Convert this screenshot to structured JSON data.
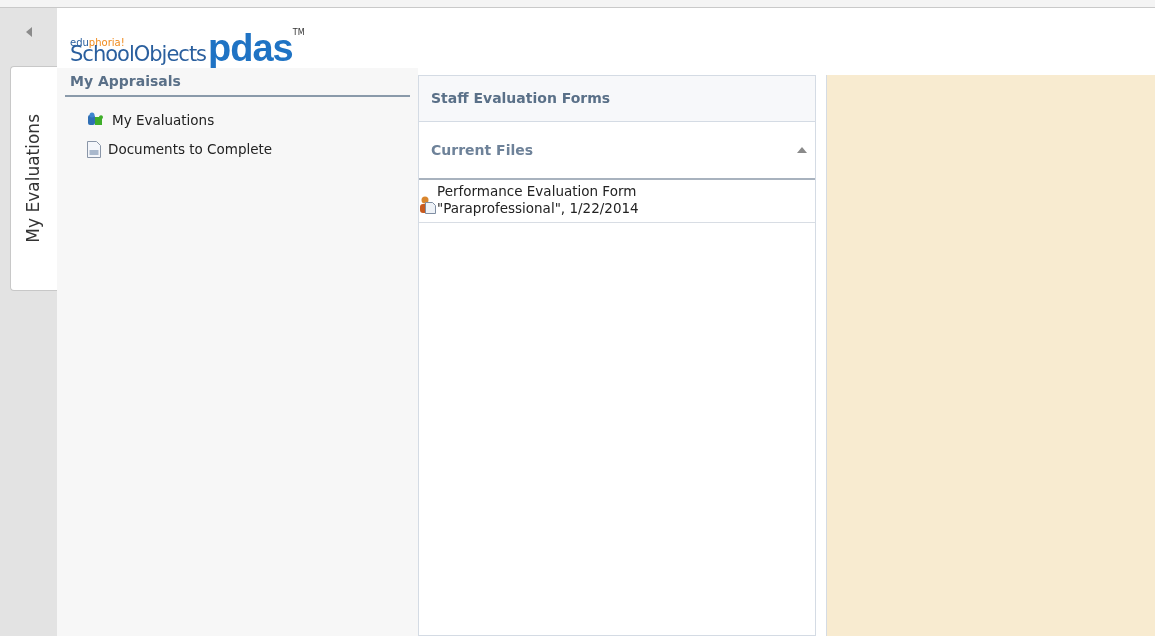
{
  "side_tab": {
    "label": "My Evaluations",
    "selected": true
  },
  "logo": {
    "prefix_a": "edu",
    "prefix_b": "phoria!",
    "name": "SchoolObjects",
    "product": "pdas",
    "mark": "TM"
  },
  "sidebar": {
    "title": "My Appraisals",
    "items": [
      {
        "label": "My Evaluations",
        "kind": "evaluations"
      },
      {
        "label": "Documents to Complete",
        "kind": "document"
      }
    ]
  },
  "forms_panel": {
    "title": "Staff Evaluation Forms",
    "section": {
      "title": "Current Files",
      "expanded": true
    },
    "files": [
      {
        "lines": [
          "Performance Evaluation Form",
          "\"Paraprofessional\", 1/22/2014"
        ]
      }
    ]
  }
}
